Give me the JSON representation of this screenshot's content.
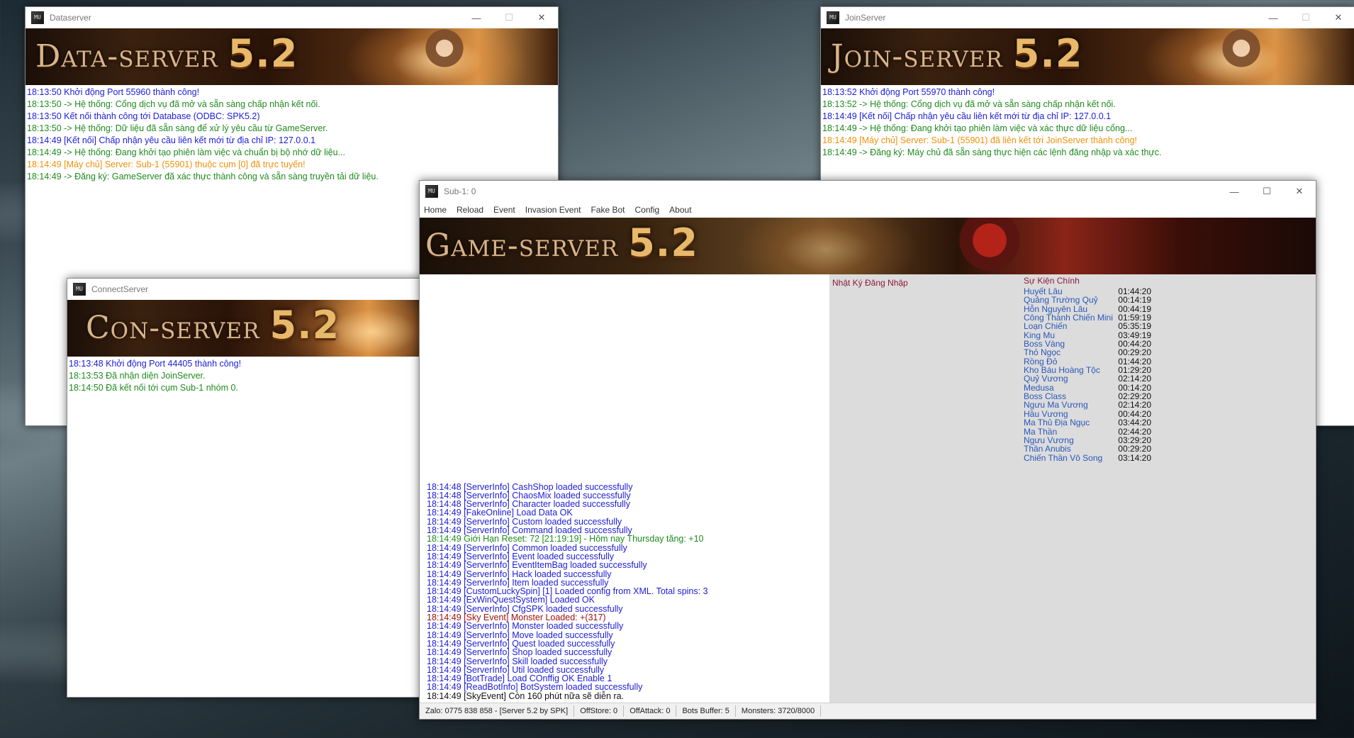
{
  "dataserver": {
    "title": "Dataserver",
    "banner": "Data-server",
    "version": "5.2",
    "log": [
      {
        "text": "18:13:50 Khởi động Port 55960 thành công!",
        "color": "blue"
      },
      {
        "text": "18:13:50 -> Hệ thống: Cổng dịch vụ đã mở và sẵn sàng chấp nhận kết nối.",
        "color": "green"
      },
      {
        "text": "18:13:50 Kết nối thành công tới Database (ODBC: SPK5.2)",
        "color": "blue"
      },
      {
        "text": "18:13:50 -> Hệ thống: Dữ liệu đã sẵn sàng để xử lý yêu cầu từ GameServer.",
        "color": "green"
      },
      {
        "text": "18:14:49 [Kết nối] Chấp nhận yêu cầu liên kết mới từ địa chỉ IP: 127.0.0.1",
        "color": "blue"
      },
      {
        "text": "18:14:49 -> Hệ thống: Đang khởi tạo phiên làm việc và chuẩn bị bộ nhớ dữ liệu...",
        "color": "green"
      },
      {
        "text": "18:14:49 [Máy chủ] Server: Sub-1 (55901) thuộc cụm [0] đã trực tuyến!",
        "color": "orange"
      },
      {
        "text": "18:14:49 -> Đăng ký: GameServer đã xác thực thành công và sẵn sàng truyền tải dữ liệu.",
        "color": "green"
      }
    ]
  },
  "joinserver": {
    "title": "JoinServer",
    "banner": "Join-server",
    "version": "5.2",
    "log": [
      {
        "text": "18:13:52 Khởi động Port 55970 thành công!",
        "color": "blue"
      },
      {
        "text": "18:13:52 -> Hệ thống: Cổng dịch vụ đã mở và sẵn sàng chấp nhận kết nối.",
        "color": "green"
      },
      {
        "text": "18:14:49 [Kết nối] Chấp nhận yêu cầu liên kết mới từ địa chỉ IP: 127.0.0.1",
        "color": "blue"
      },
      {
        "text": "18:14:49 -> Hệ thống: Đang khởi tạo phiên làm việc và xác thực dữ liệu cổng...",
        "color": "green"
      },
      {
        "text": "18:14:49 [Máy chủ] Server: Sub-1 (55901) đã liên kết tới JoinServer thành công!",
        "color": "orange"
      },
      {
        "text": "18:14:49 -> Đăng ký: Máy chủ đã sẵn sàng thực hiện các lệnh đăng nhập và xác thực.",
        "color": "green"
      }
    ]
  },
  "connectserver": {
    "title": "ConnectServer",
    "banner": "Con-server",
    "version": "5.2",
    "log": [
      {
        "text": "18:13:48 Khởi động Port 44405 thành công!",
        "color": "blue"
      },
      {
        "text": "18:13:53 Đã nhận diện JoinServer.",
        "color": "green"
      },
      {
        "text": "18:14:50 Đã kết nối tới cụm Sub-1 nhóm 0.",
        "color": "green"
      }
    ]
  },
  "gameserver": {
    "title": "Sub-1: 0",
    "banner": "Game-server",
    "version": "5.2",
    "menu": [
      "Home",
      "Reload",
      "Event",
      "Invasion Event",
      "Fake Bot",
      "Config",
      "About"
    ],
    "log": [
      {
        "text": "18:14:48 [ServerInfo] CashShop loaded successfully",
        "color": "blue"
      },
      {
        "text": "18:14:48 [ServerInfo] ChaosMix loaded successfully",
        "color": "blue"
      },
      {
        "text": "18:14:48 [ServerInfo] Character loaded successfully",
        "color": "blue"
      },
      {
        "text": "18:14:49 [FakeOnline] Load Data OK",
        "color": "blue"
      },
      {
        "text": "18:14:49 [ServerInfo] Custom loaded successfully",
        "color": "blue"
      },
      {
        "text": "18:14:49 [ServerInfo] Command loaded successfully",
        "color": "blue"
      },
      {
        "text": "18:14:49 Giới Hạn Reset: 72 [21:19:19] - Hôm nay Thursday tăng: +10",
        "color": "green"
      },
      {
        "text": "18:14:49 [ServerInfo] Common loaded successfully",
        "color": "blue"
      },
      {
        "text": "18:14:49 [ServerInfo] Event loaded successfully",
        "color": "blue"
      },
      {
        "text": "18:14:49 [ServerInfo] EventItemBag loaded successfully",
        "color": "blue"
      },
      {
        "text": "18:14:49 [ServerInfo] Hack loaded successfully",
        "color": "blue"
      },
      {
        "text": "18:14:49 [ServerInfo] Item loaded successfully",
        "color": "blue"
      },
      {
        "text": "18:14:49 [CustomLuckySpin] [1] Loaded config from XML. Total spins: 3",
        "color": "blue"
      },
      {
        "text": "18:14:49 [ExWinQuestSystem] Loaded OK",
        "color": "blue"
      },
      {
        "text": "18:14:49 [ServerInfo] CfgSPK loaded successfully",
        "color": "blue"
      },
      {
        "text": "18:14:49 [Sky Event] Monster Loaded: +(317)",
        "color": "red"
      },
      {
        "text": "18:14:49 [ServerInfo] Monster loaded successfully",
        "color": "blue"
      },
      {
        "text": "18:14:49 [ServerInfo] Move loaded successfully",
        "color": "blue"
      },
      {
        "text": "18:14:49 [ServerInfo] Quest loaded successfully",
        "color": "blue"
      },
      {
        "text": "18:14:49 [ServerInfo] Shop loaded successfully",
        "color": "blue"
      },
      {
        "text": "18:14:49 [ServerInfo] Skill loaded successfully",
        "color": "blue"
      },
      {
        "text": "18:14:49 [ServerInfo] Util loaded successfully",
        "color": "blue"
      },
      {
        "text": "18:14:49 [BotTrade] Load COnffig OK Enable 1",
        "color": "blue"
      },
      {
        "text": "18:14:49 [ReadBotInfo] BotSystem loaded successfully",
        "color": "blue"
      },
      {
        "text": "18:14:49 [SkyEvent] Còn 160 phút nữa sẽ diễn ra.",
        "color": "black"
      }
    ],
    "login_log_title": "Nhật Ký Đăng Nhập",
    "events_title": "Sự Kiện Chính",
    "events": [
      {
        "name": "Huyết Lâu",
        "time": "01:44:20"
      },
      {
        "name": "Quảng Trường Quỷ",
        "time": "00:14:19"
      },
      {
        "name": "Hỗn Nguyên Lâu",
        "time": "00:44:19"
      },
      {
        "name": "Công Thành Chiến Mini",
        "time": "01:59:19"
      },
      {
        "name": "Loạn Chiến",
        "time": "05:35:19"
      },
      {
        "name": "King Mu",
        "time": "03:49:19"
      },
      {
        "name": "Boss Vàng",
        "time": "00:44:20"
      },
      {
        "name": "Thỏ Ngọc",
        "time": "00:29:20"
      },
      {
        "name": "Rồng Đỏ",
        "time": "01:44:20"
      },
      {
        "name": "Kho Báu Hoàng Tộc",
        "time": "01:29:20"
      },
      {
        "name": "Quỷ Vương",
        "time": "02:14:20"
      },
      {
        "name": "Medusa",
        "time": "00:14:20"
      },
      {
        "name": "Boss Class",
        "time": "02:29:20"
      },
      {
        "name": "Ngưu Ma Vương",
        "time": "02:14:20"
      },
      {
        "name": "Hầu Vương",
        "time": "00:44:20"
      },
      {
        "name": "Ma Thủ Địa Ngục",
        "time": "03:44:20"
      },
      {
        "name": "Ma Thần",
        "time": "02:44:20"
      },
      {
        "name": "Ngưu Vương",
        "time": "03:29:20"
      },
      {
        "name": "Thần Anubis",
        "time": "00:29:20"
      },
      {
        "name": "Chiến Thần Vô Song",
        "time": "03:14:20"
      }
    ],
    "status": [
      "Zalo: 0775 838 858 - [Server 5.2 by SPK]",
      "OffStore: 0",
      "OffAttack: 0",
      "Bots Buffer: 5",
      "Monsters: 3720/8000"
    ]
  },
  "colors": {
    "blue": "#1c1cd8",
    "green": "#1f8a1f",
    "orange": "#f0910a",
    "red": "#a01010",
    "black": "#111111",
    "event_name": "#2a57b8",
    "panel_title": "#8b1a3a"
  },
  "icons": {
    "app": "mu-app-icon",
    "minimize": "minimize-icon",
    "maximize": "maximize-icon",
    "close": "close-icon"
  }
}
